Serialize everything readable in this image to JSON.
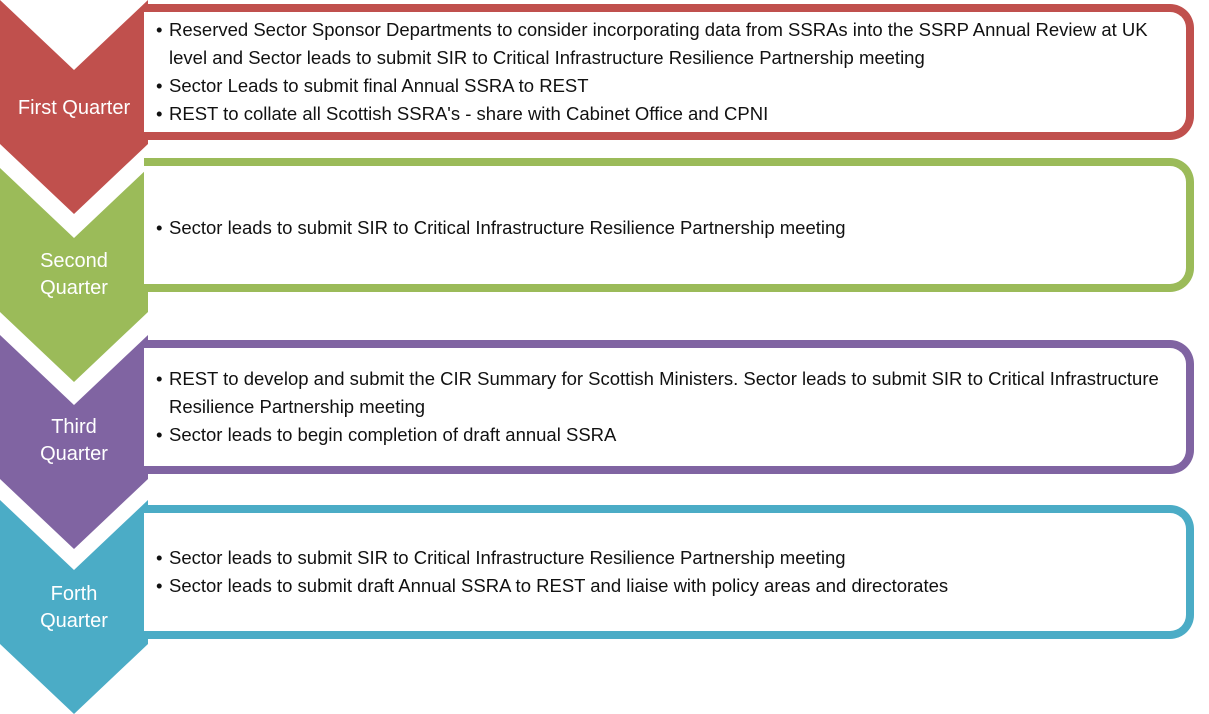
{
  "colors": {
    "q1": "#c0504d",
    "q2": "#9bbb59",
    "q3": "#8064a2",
    "q4": "#4bacc6"
  },
  "quarters": [
    {
      "label": "First Quarter",
      "items": [
        "Reserved Sector Sponsor Departments to consider incorporating data from SSRAs into the SSRP Annual Review at UK level and Sector leads to submit SIR  to Critical Infrastructure Resilience Partnership  meeting",
        "Sector Leads to submit final Annual SSRA to REST",
        "REST to collate all Scottish SSRA's - share with Cabinet Office and CPNI"
      ]
    },
    {
      "label": "Second Quarter",
      "items": [
        "Sector leads to submit SIR to Critical Infrastructure Resilience Partnership  meeting"
      ]
    },
    {
      "label": "Third Quarter",
      "items": [
        "REST to develop and submit the CIR Summary for Scottish Ministers. Sector leads to submit  SIR  to Critical Infrastructure Resilience Partnership  meeting",
        "Sector leads to begin completion of draft annual SSRA"
      ]
    },
    {
      "label": "Forth Quarter",
      "items": [
        "Sector leads to submit  SIR  to Critical Infrastructure Resilience Partnership  meeting",
        "Sector leads to submit draft Annual SSRA to REST and liaise with policy areas and directorates"
      ]
    }
  ]
}
